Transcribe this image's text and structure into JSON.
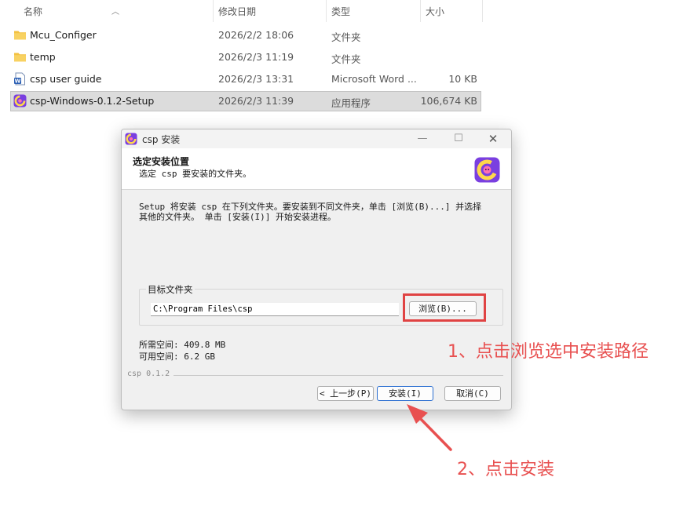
{
  "explorer": {
    "columns": {
      "name": "名称",
      "modified": "修改日期",
      "type": "类型",
      "size": "大小"
    },
    "files": [
      {
        "name": "Mcu_Configer",
        "modified": "2026/2/2 18:06",
        "type": "文件夹",
        "size": "",
        "icon": "folder-icon"
      },
      {
        "name": "temp",
        "modified": "2026/2/3 11:19",
        "type": "文件夹",
        "size": "",
        "icon": "folder-icon"
      },
      {
        "name": "csp user guide",
        "modified": "2026/2/3 13:31",
        "type": "Microsoft Word ...",
        "size": "10 KB",
        "icon": "word-document-icon"
      },
      {
        "name": "csp-Windows-0.1.2-Setup",
        "modified": "2026/2/3 11:39",
        "type": "应用程序",
        "size": "106,674 KB",
        "icon": "csp-app-icon",
        "selected": true
      }
    ]
  },
  "dialog": {
    "title": "csp 安装",
    "header_title": "选定安装位置",
    "header_subtitle": "选定 csp 要安装的文件夹。",
    "intro_text": "Setup 将安装 csp 在下列文件夹。要安装到不同文件夹，单击 [浏览(B)...] 并选择\n其他的文件夹。 单击 [安装(I)] 开始安装进程。",
    "dest_group_label": "目标文件夹",
    "dest_path": "C:\\Program Files\\csp",
    "browse_label": "浏览(B)...",
    "space_required": "所需空间: 409.8 MB",
    "space_available": "可用空间: 6.2 GB",
    "brand_text": "csp 0.1.2",
    "back_label": "< 上一步(P)",
    "install_label": "安装(I)",
    "cancel_label": "取消(C)"
  },
  "annotations": {
    "step1": "1、点击浏览选中安装路径",
    "step2": "2、点击安装",
    "color": "#e85050"
  }
}
